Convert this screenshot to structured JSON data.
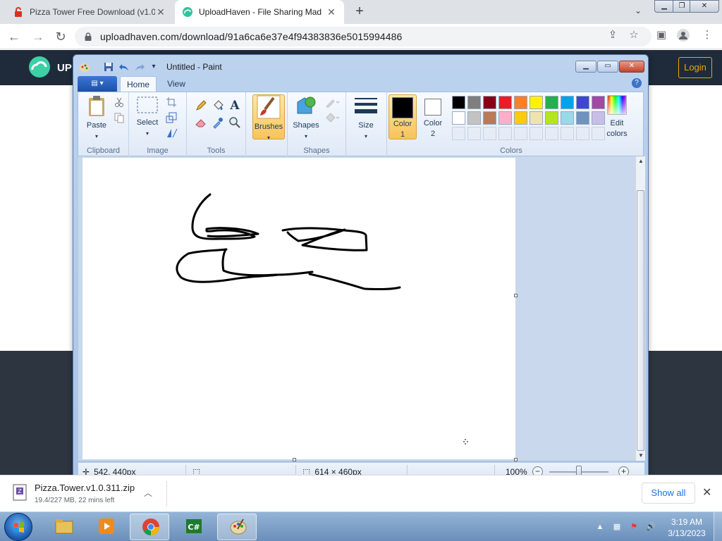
{
  "browser": {
    "tabs": [
      {
        "title": "Pizza Tower Free Download (v1.0",
        "active": false
      },
      {
        "title": "UploadHaven - File Sharing Mad",
        "active": true
      }
    ],
    "new_tab": "+",
    "url": "uploadhaven.com/download/91a6ca6e37e4f94383836e5015994486"
  },
  "site": {
    "brand": "UP",
    "login_label": "Login"
  },
  "paint": {
    "title": "Untitled - Paint",
    "tabs": [
      "Home",
      "View"
    ],
    "groups": {
      "clipboard": {
        "label": "Clipboard",
        "paste": "Paste"
      },
      "image": {
        "label": "Image",
        "select": "Select"
      },
      "tools": {
        "label": "Tools"
      },
      "brushes": {
        "label": "Brushes"
      },
      "shapes": {
        "label": "Shapes",
        "shapes_btn": "Shapes"
      },
      "size": {
        "label": "Size"
      },
      "colors": {
        "label": "Colors",
        "color1": "Color 1",
        "color1_line1": "Color",
        "color1_line2": "1",
        "color2_line1": "Color",
        "color2_line2": "2",
        "edit_line1": "Edit",
        "edit_line2": "colors",
        "color1_value": "#000000",
        "color2_value": "#ffffff",
        "palette_row1": [
          "#000000",
          "#7f7f7f",
          "#880015",
          "#ed1c24",
          "#ff7f27",
          "#fff200",
          "#22b14c",
          "#00a2e8",
          "#3f48cc",
          "#a349a4"
        ],
        "palette_row2": [
          "#ffffff",
          "#c3c3c3",
          "#b97a57",
          "#ffaec9",
          "#ffc90e",
          "#efe4b0",
          "#b5e61d",
          "#99d9ea",
          "#7092be",
          "#c8bfe7"
        ]
      }
    },
    "status": {
      "cursor_pos": "542, 440px",
      "canvas_size": "614 × 460px",
      "zoom": "100%"
    }
  },
  "download": {
    "filename": "Pizza.Tower.v1.0.311.zip",
    "status": "19.4/227 MB, 22 mins left",
    "show_all": "Show all"
  },
  "taskbar": {
    "time": "3:19 AM",
    "date": "3/13/2023"
  }
}
